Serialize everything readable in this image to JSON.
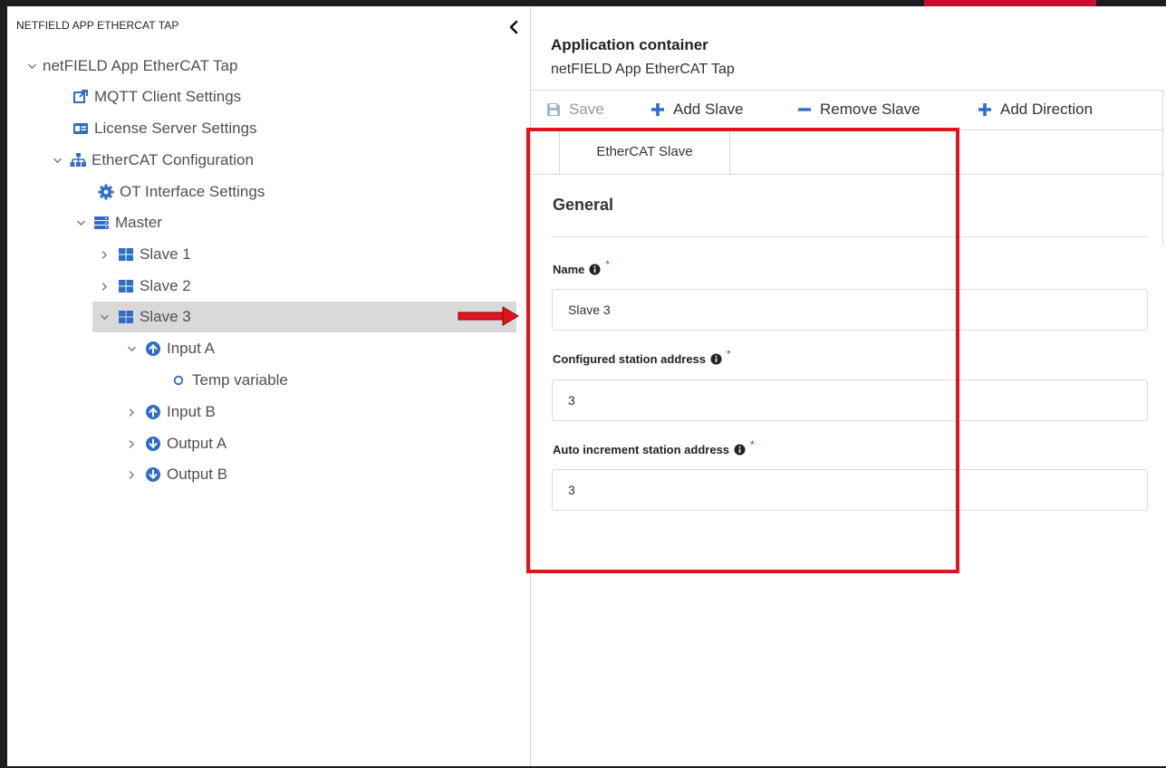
{
  "tree": {
    "title": "NETFIELD APP ETHERCAT TAP",
    "items": [
      {
        "label": "netFIELD App EtherCAT Tap",
        "icon": "chevron-down-icon"
      },
      {
        "label": "MQTT Client Settings",
        "icon": "external-edit-icon"
      },
      {
        "label": "License Server Settings",
        "icon": "id-card-icon"
      },
      {
        "label": "EtherCAT Configuration",
        "icon": "network-tree-icon"
      },
      {
        "label": "OT Interface Settings",
        "icon": "gear-icon"
      },
      {
        "label": "Master",
        "icon": "server-icon"
      },
      {
        "label": "Slave 1",
        "icon": "grid-icon"
      },
      {
        "label": "Slave 2",
        "icon": "grid-icon"
      },
      {
        "label": "Slave 3",
        "icon": "grid-icon"
      },
      {
        "label": "Input A",
        "icon": "arrow-up-circle-icon"
      },
      {
        "label": "Temp variable",
        "icon": "circle-outline-icon"
      },
      {
        "label": "Input B",
        "icon": "arrow-up-circle-icon"
      },
      {
        "label": "Output A",
        "icon": "arrow-down-circle-icon"
      },
      {
        "label": "Output B",
        "icon": "arrow-down-circle-icon"
      }
    ],
    "selected": "Slave 3"
  },
  "header": {
    "title": "Application container",
    "subtitle": "netFIELD App EtherCAT Tap"
  },
  "toolbar": {
    "save": "Save",
    "add_slave": "Add Slave",
    "remove_slave": "Remove Slave",
    "add_direction": "Add Direction"
  },
  "tabs": [
    {
      "label": "EtherCAT Slave"
    }
  ],
  "form": {
    "section": "General",
    "fields": [
      {
        "label": "Name",
        "value": "Slave 3"
      },
      {
        "label": "Configured station address",
        "value": "3"
      },
      {
        "label": "Auto increment station address",
        "value": "3"
      }
    ],
    "required_mark": "*"
  },
  "colors": {
    "accent_blue": "#2f6ec7",
    "highlight_red": "#e0141e",
    "selected_row": "#d9d9d9"
  }
}
